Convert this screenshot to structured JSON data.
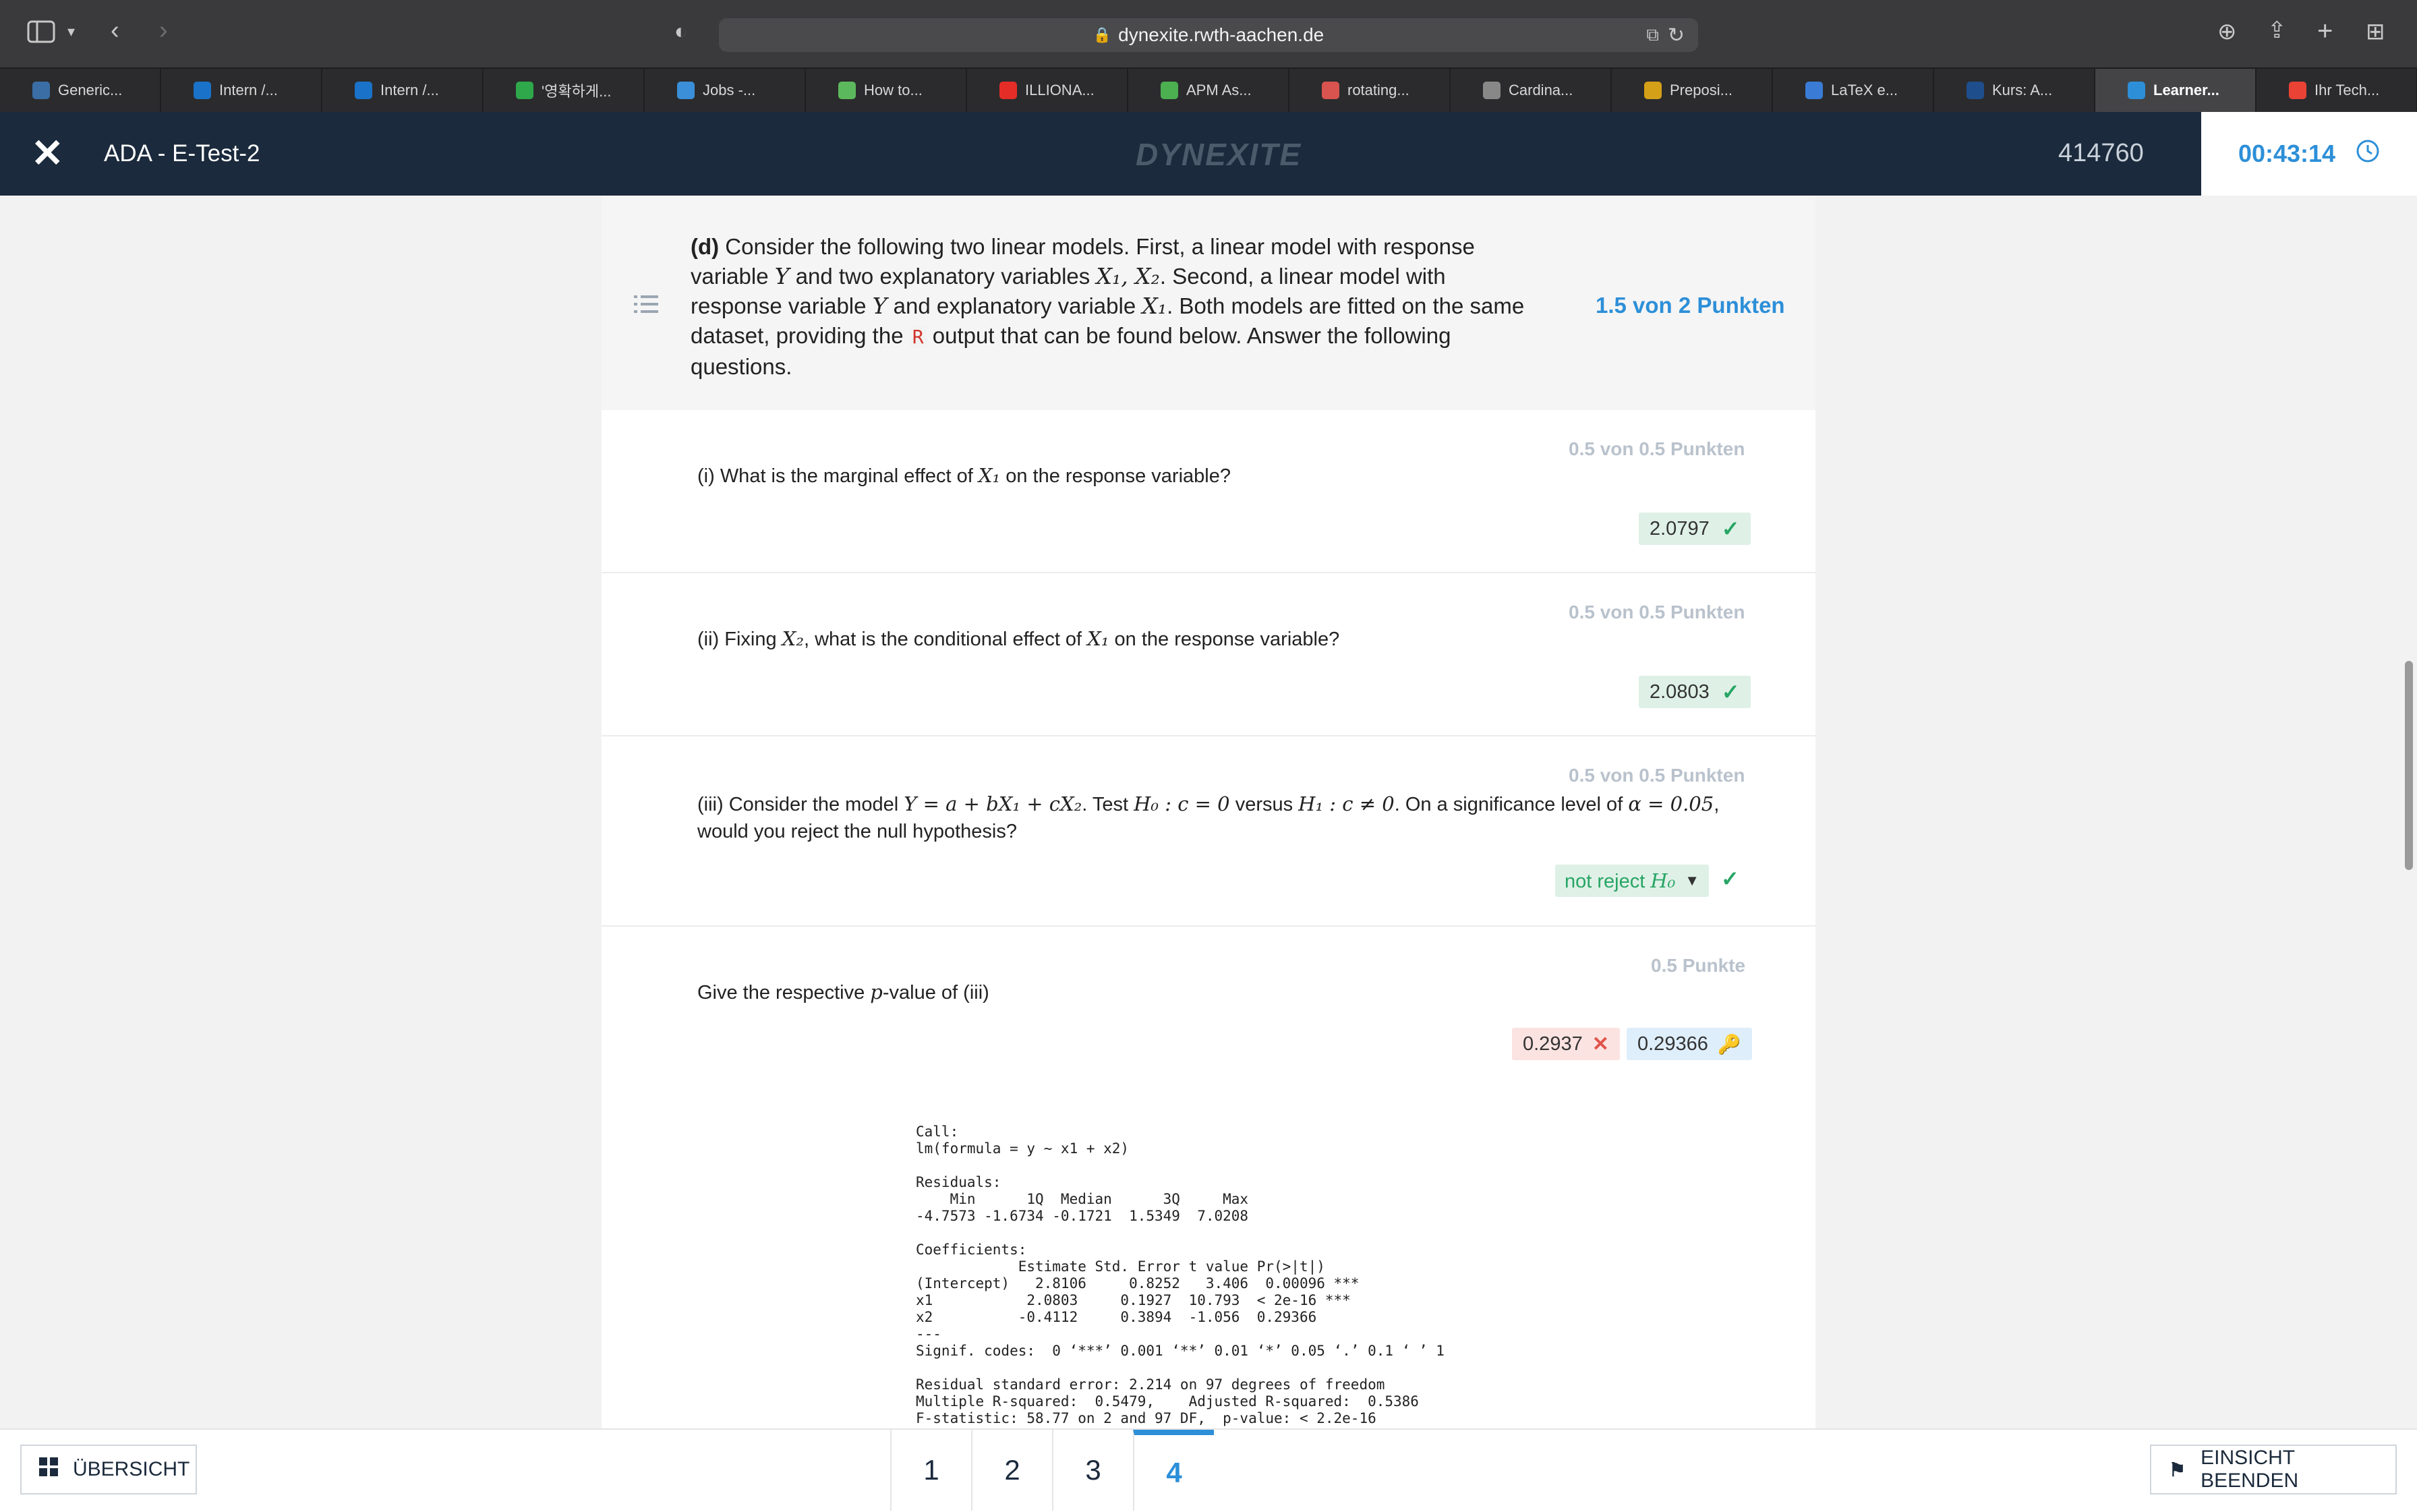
{
  "browser": {
    "url": "dynexite.rwth-aachen.de",
    "tabs": [
      {
        "label": "Generic...",
        "icon": "rwth-icon",
        "color": "#3a6ea5"
      },
      {
        "label": "Intern /...",
        "icon": "sap-icon",
        "color": "#1a73c9"
      },
      {
        "label": "Intern /...",
        "icon": "sap-icon",
        "color": "#1a73c9"
      },
      {
        "label": "'영확하게...",
        "icon": "hangul-icon",
        "color": "#2ea84a"
      },
      {
        "label": "Jobs -...",
        "icon": "globe-icon",
        "color": "#3a8fd8"
      },
      {
        "label": "How to...",
        "icon": "feather-icon",
        "color": "#5cb85c"
      },
      {
        "label": "ILLIONA...",
        "icon": "youtube-icon",
        "color": "#e52d27"
      },
      {
        "label": "APM As...",
        "icon": "openai-icon",
        "color": "#4caf50"
      },
      {
        "label": "rotating...",
        "icon": "braces-icon",
        "color": "#d9534f"
      },
      {
        "label": "Cardina...",
        "icon": "image-icon",
        "color": "#888888"
      },
      {
        "label": "Preposi...",
        "icon": "doc-icon",
        "color": "#d4a017"
      },
      {
        "label": "LaTeX e...",
        "icon": "latex-icon",
        "color": "#3a7bd5"
      },
      {
        "label": "Kurs: A...",
        "icon": "rwth-icon",
        "color": "#1e4e8c"
      },
      {
        "label": "Learner...",
        "icon": "learner-icon",
        "color": "#2d8fd8",
        "active": true
      },
      {
        "label": "Ihr Tech...",
        "icon": "gmail-icon",
        "color": "#ea4335"
      }
    ]
  },
  "header": {
    "title": "ADA - E-Test-2",
    "brand": "DYNEXITE",
    "user_id": "414760",
    "timer": "00:43:14"
  },
  "question": {
    "label": "(d)",
    "text_a": " Consider the following two linear models. First, a linear model with response",
    "text_b1": "variable ",
    "var_y": "Y",
    "text_b2": " and two explanatory variables ",
    "var_x1x2": "X₁, X₂",
    "text_b3": ". Second, a linear model with",
    "text_c1": "response variable ",
    "text_c2": " and explanatory variable ",
    "var_x1": "X₁",
    "text_c3": ". Both models are fitted on the same",
    "text_d1": "dataset, providing the ",
    "r_code": "R",
    "text_d2": " output that can be found below. Answer the following",
    "text_e": "questions.",
    "points": "1.5 von 2 Punkten"
  },
  "subquestions": [
    {
      "points": "0.5 von 0.5 Punkten",
      "text_a": "(i) What is the marginal effect of ",
      "var": "X₁",
      "text_b": " on the response variable?",
      "answer": "2.0797"
    },
    {
      "points": "0.5 von 0.5 Punkten",
      "text_a": "(ii) Fixing ",
      "var_a": "X₂",
      "text_b": ", what is the conditional effect of ",
      "var_b": "X₁",
      "text_c": " on the response variable?",
      "answer": "2.0803"
    },
    {
      "points": "0.5 von 0.5 Punkten",
      "text_a": "(iii) Consider the model ",
      "model": "Y = a + bX₁ + cX₂",
      "text_b": ". Test ",
      "h0": "H₀ : c = 0",
      "text_c": " versus ",
      "h1": "H₁ : c ≠ 0",
      "text_d": ". On a significance level of ",
      "alpha": "α = 0.05",
      "text_e": ",",
      "text_f": "would you reject the null hypothesis?",
      "answer_a": "not reject ",
      "answer_b": "H₀"
    },
    {
      "points": "0.5 Punkte",
      "text_a": "Give the respective ",
      "var": "p",
      "text_b": "-value of (iii)",
      "answer_wrong": "0.2937",
      "answer_correct": "0.29366"
    }
  ],
  "r_output": {
    "lines": [
      "Call:",
      "lm(formula = y ~ x1 + x2)",
      "",
      "Residuals:",
      "    Min      1Q  Median      3Q     Max",
      "-4.7573 -1.6734 -0.1721  1.5349  7.0208",
      "",
      "Coefficients:",
      "            Estimate Std. Error t value Pr(>|t|)",
      "(Intercept)   2.8106     0.8252   3.406  0.00096 ***",
      "x1           2.0803     0.1927  10.793  < 2e-16 ***",
      "x2          -0.4112     0.3894  -1.056  0.29366",
      "---",
      "Signif. codes:  0 ‘***’ 0.001 ‘**’ 0.01 ‘*’ 0.05 ‘.’ 0.1 ‘ ’ 1",
      "",
      "Residual standard error: 2.214 on 97 degrees of freedom",
      "Multiple R-squared:  0.5479,\tAdjusted R-squared:  0.5386",
      "F-statistic: 58.77 on 2 and 97 DF,  p-value: < 2.2e-16"
    ]
  },
  "footer": {
    "overview_label": "ÜBERSICHT",
    "pages": [
      "1",
      "2",
      "3",
      "4"
    ],
    "active_page": "4",
    "end_label": "EINSICHT BEENDEN"
  },
  "colors": {
    "header_bg": "#1b2a3c",
    "accent": "#2d8fd8",
    "correct": "#27a564",
    "wrong": "#e0534a"
  }
}
